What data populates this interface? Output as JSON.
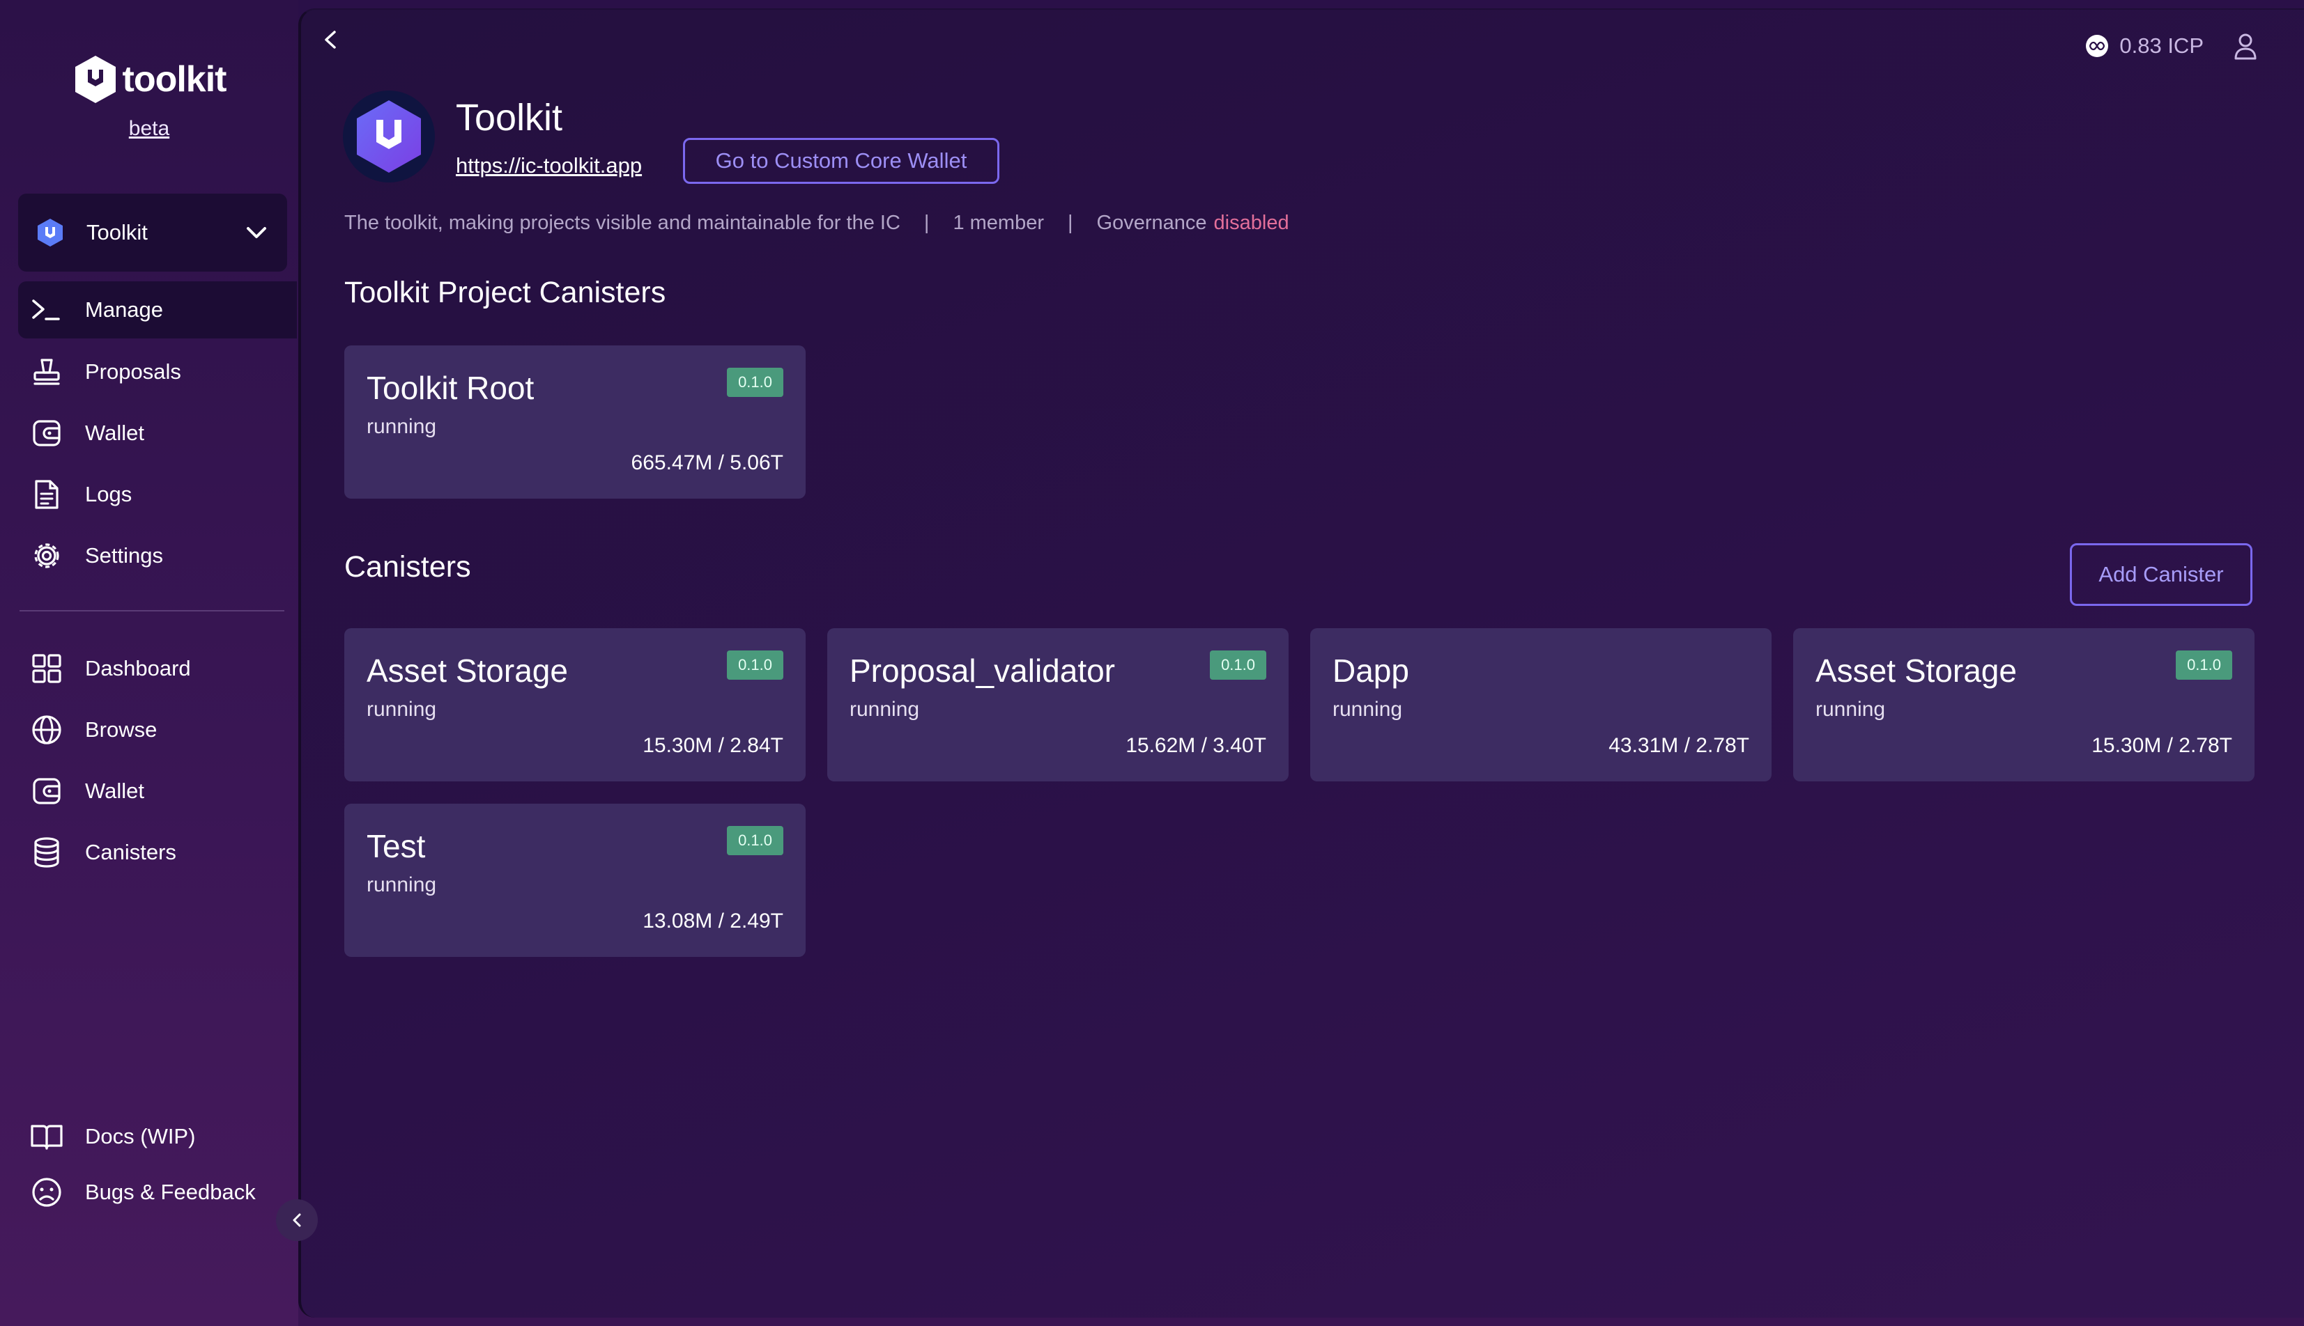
{
  "brand": {
    "name": "toolkit",
    "tag": "beta"
  },
  "project_selector": {
    "label": "Toolkit"
  },
  "nav": {
    "project": [
      {
        "label": "Manage",
        "icon": "terminal-icon"
      },
      {
        "label": "Proposals",
        "icon": "stamp-icon"
      },
      {
        "label": "Wallet",
        "icon": "wallet-icon"
      },
      {
        "label": "Logs",
        "icon": "document-icon"
      },
      {
        "label": "Settings",
        "icon": "gear-icon"
      }
    ],
    "global": [
      {
        "label": "Dashboard",
        "icon": "grid-icon"
      },
      {
        "label": "Browse",
        "icon": "globe-icon"
      },
      {
        "label": "Wallet",
        "icon": "wallet-icon"
      },
      {
        "label": "Canisters",
        "icon": "database-icon"
      }
    ],
    "footer": [
      {
        "label": "Docs (WIP)",
        "icon": "book-icon"
      },
      {
        "label": "Bugs & Feedback",
        "icon": "sad-face-icon"
      }
    ]
  },
  "header": {
    "balance": "0.83 ICP"
  },
  "project": {
    "title": "Toolkit",
    "url": "https://ic-toolkit.app",
    "wallet_button": "Go to Custom Core Wallet",
    "description": "The toolkit, making projects visible and maintainable for the IC",
    "members": "1 member",
    "governance_label": "Governance",
    "governance_status": "disabled",
    "separator": "|"
  },
  "sections": {
    "project_canisters_title": "Toolkit Project Canisters",
    "canisters_title": "Canisters",
    "add_canister_button": "Add Canister"
  },
  "project_canisters": [
    {
      "name": "Toolkit Root",
      "status": "running",
      "usage": "665.47M / 5.06T",
      "version": "0.1.0"
    }
  ],
  "canisters": [
    {
      "name": "Asset Storage",
      "status": "running",
      "usage": "15.30M / 2.84T",
      "version": "0.1.0"
    },
    {
      "name": "Proposal_validator",
      "status": "running",
      "usage": "15.62M / 3.40T",
      "version": "0.1.0"
    },
    {
      "name": "Dapp",
      "status": "running",
      "usage": "43.31M / 2.78T",
      "version": ""
    },
    {
      "name": "Asset Storage",
      "status": "running",
      "usage": "15.30M / 2.78T",
      "version": "0.1.0"
    },
    {
      "name": "Test",
      "status": "running",
      "usage": "13.08M / 2.49T",
      "version": "0.1.0"
    }
  ],
  "colors": {
    "accent": "#7b68ee",
    "version_badge": "#4a9a7c",
    "governance_disabled": "#e36f9a",
    "card_bg": "#3d2c62"
  }
}
